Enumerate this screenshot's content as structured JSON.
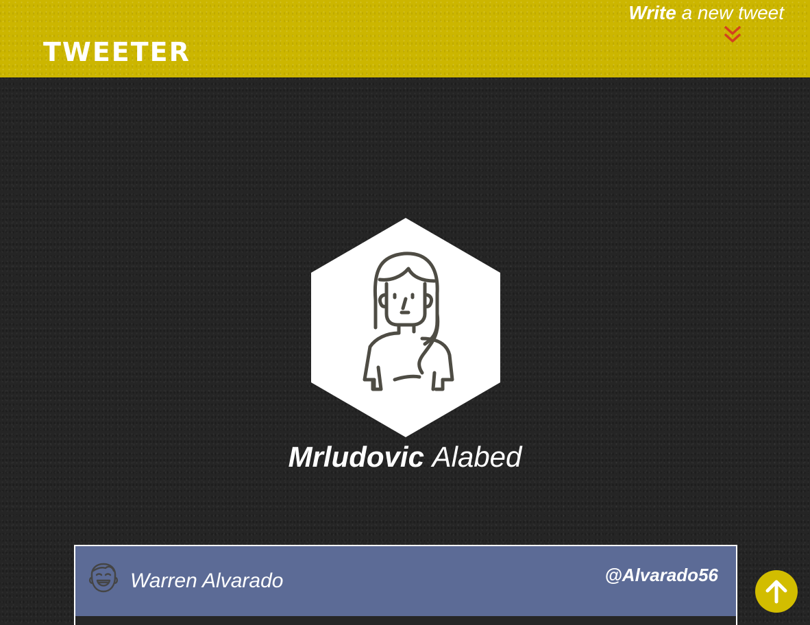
{
  "navbar": {
    "brand": "Tweeter",
    "write_bold": "Write",
    "write_rest": " a new tweet",
    "write_icon": "double-chevron-down-icon"
  },
  "profile": {
    "avatar_icon": "woman-avatar-icon",
    "first_name": "Mrludovic",
    "last_name": "Alabed"
  },
  "tweets": [
    {
      "avatar_icon": "laughing-man-avatar-icon",
      "name": "Warren Alvarado",
      "handle": "@Alvarado56"
    }
  ],
  "scroll_top": {
    "icon": "arrow-up-icon"
  },
  "colors": {
    "navbar": "#ccb600",
    "page_background": "#252525",
    "tweet_header": "#5c6b96",
    "chevron": "#d4411e",
    "scroll_button": "#d2bd00"
  }
}
